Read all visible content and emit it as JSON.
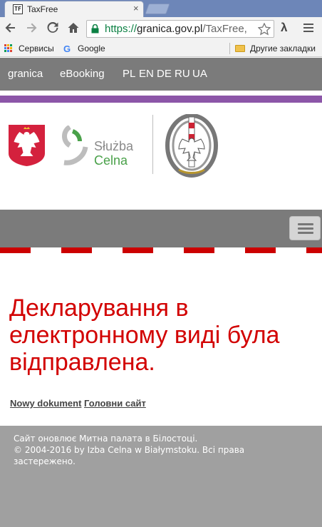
{
  "browser": {
    "tab_title": "TaxFree",
    "tab_close": "×",
    "favicon_text": "TF",
    "url_scheme": "https://",
    "url_host": "granica.gov.pl",
    "url_rest": "/TaxFree,",
    "extension_label": "λ",
    "bookmarks": {
      "services": "Сервисы",
      "google": "Google",
      "google_glyph": "G",
      "other": "Другие закладки"
    },
    "icons": {
      "back": "back-arrow-icon",
      "forward": "forward-arrow-icon",
      "reload": "reload-icon",
      "home": "home-icon",
      "lock": "lock-icon",
      "star": "star-icon",
      "menu": "menu-icon"
    }
  },
  "site": {
    "nav": {
      "items": [
        "granica",
        "eBooking"
      ],
      "languages": [
        "PL",
        "EN",
        "DE",
        "RU",
        "UA"
      ]
    },
    "logo": {
      "sluzba_line1": "Służba",
      "sluzba_line2": "Celna"
    },
    "colors": {
      "accent_red": "#d20000",
      "nav_grey": "#7b7b7b",
      "purple_bar": "#8c56a8",
      "footer_grey": "#a0a0a0"
    }
  },
  "main": {
    "headline": "Декларування в електронному виді була відправлена.",
    "links": [
      "Nowy dokument",
      "Головни сайт"
    ]
  },
  "footer": {
    "line1": "Сайт оновлює Митна палата в Білостоці.",
    "line2": "© 2004-2016 by Izba Celna w Białymstoku. Всі права застережено."
  }
}
